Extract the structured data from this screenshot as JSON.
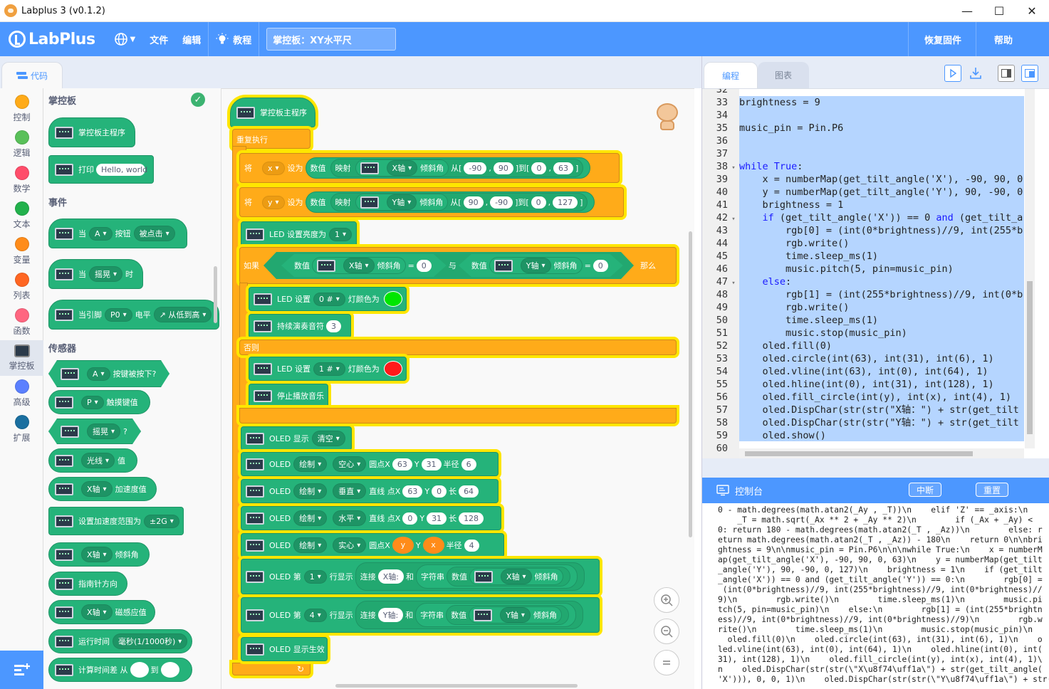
{
  "window": {
    "title": "Labplus 3 (v0.1.2)",
    "minimize": "—",
    "maximize": "☐",
    "close": "✕"
  },
  "header": {
    "logo": "LabPlus",
    "menu_file": "文件",
    "menu_edit": "编辑",
    "menu_tutorial": "教程",
    "project_name": "掌控板：XY水平尺",
    "restore_firmware": "恢复固件",
    "help": "帮助"
  },
  "tabs": {
    "code": "代码",
    "program": "编程",
    "chart": "图表"
  },
  "categories": [
    {
      "label": "控制",
      "color": "#ffab19"
    },
    {
      "label": "逻辑",
      "color": "#59c059"
    },
    {
      "label": "数学",
      "color": "#ff4d6a"
    },
    {
      "label": "文本",
      "color": "#22b14c"
    },
    {
      "label": "变量",
      "color": "#ff8c1a"
    },
    {
      "label": "列表",
      "color": "#ff6622"
    },
    {
      "label": "函数",
      "color": "#ff6680"
    },
    {
      "label": "掌控板",
      "color": "#2b3a4a"
    },
    {
      "label": "高级",
      "color": "#5b80ff"
    },
    {
      "label": "扩展",
      "color": "#1a6fa0"
    }
  ],
  "flyout": {
    "head_board": "掌控板",
    "head_events": "事件",
    "head_sensors": "传感器",
    "blocks": {
      "main_program": "掌控板主程序",
      "print": "打印",
      "print_value": "Hello, world",
      "when": "当",
      "btn_a": "A",
      "button": "按钮",
      "clicked": "被点击",
      "shake": "摇晃",
      "time_suffix": "时",
      "when_pin": "当引脚",
      "pin_p0": "P0",
      "level": "电平",
      "low_to_high": "↗ 从低到高",
      "btn_pressed": "按键被按下?",
      "pin_p": "P",
      "touch_key": "触摸键值",
      "question": "?",
      "light": "光线",
      "value": "值",
      "x_axis": "X轴",
      "accel": "加速度值",
      "set_accel_range": "设置加速度范围为",
      "range_2g": "±2G",
      "tilt": "倾斜角",
      "compass": "指南针方向",
      "mag": "磁感应值",
      "runtime": "运行时间",
      "ms": "毫秒(1/1000秒)",
      "time_diff_from": "计算时间差 从",
      "to": "到"
    }
  },
  "workspace": {
    "hat": "掌控板主程序",
    "repeat": "重复执行",
    "set": "将",
    "var_x": "x",
    "var_y": "y",
    "set_to": "设为",
    "num": "数值",
    "map": "映射",
    "x_axis": "X轴",
    "y_axis": "Y轴",
    "tilt": "倾斜角",
    "from": "从[",
    "to_bracket": "]到[",
    "close_bracket": "]",
    "x_map": [
      "-90",
      "90",
      "0",
      "63"
    ],
    "y_map": [
      "90",
      "-90",
      "0",
      "127"
    ],
    "led_brightness": "LED 设置亮度为",
    "brightness_val": "1",
    "if": "如果",
    "eq": "=",
    "zero": "0",
    "and": "与",
    "then": "那么",
    "led_set": "LED 设置",
    "led0": "0 #",
    "led1": "1 #",
    "light_color": "灯颜色为",
    "color_green": "#00e600",
    "color_red": "#ff1a1a",
    "play_note": "持续演奏音符",
    "note_val": "3",
    "else": "否则",
    "stop_music": "停止播放音乐",
    "oled_show": "OLED 显示",
    "clear": "清空",
    "oled": "OLED",
    "draw": "绘制",
    "hollow": "空心",
    "solid": "实心",
    "vertical": "垂直",
    "horizontal": "水平",
    "circle_x": "圆点X",
    "line_x": "直线 点X",
    "Y": "Y",
    "radius": "半径",
    "len": "长",
    "c1": [
      "63",
      "31",
      "6"
    ],
    "c2": [
      "63",
      "0",
      "64"
    ],
    "c3": [
      "0",
      "31",
      "128"
    ],
    "c4": [
      "y",
      "x",
      "4"
    ],
    "oled_line": "OLED 第",
    "line1": "1",
    "line4": "4",
    "row_show": "行显示",
    "join": "连接",
    "x_label": "X轴:",
    "y_label": "Y轴:",
    "and2": "和",
    "string": "字符串",
    "oled_apply": "OLED 显示生效"
  },
  "editor": {
    "lines": [
      {
        "n": "32",
        "t": ""
      },
      {
        "n": "33",
        "t": "brightness = 9"
      },
      {
        "n": "34",
        "t": ""
      },
      {
        "n": "35",
        "t": "music_pin = Pin.P6"
      },
      {
        "n": "36",
        "t": ""
      },
      {
        "n": "37",
        "t": ""
      },
      {
        "n": "38",
        "t": "while True:",
        "fold": "▾"
      },
      {
        "n": "39",
        "t": "    x = numberMap(get_tilt_angle('X'), -90, 90, 0"
      },
      {
        "n": "40",
        "t": "    y = numberMap(get_tilt_angle('Y'), 90, -90, 0"
      },
      {
        "n": "41",
        "t": "    brightness = 1"
      },
      {
        "n": "42",
        "t": "    if (get_tilt_angle('X')) == 0 and (get_tilt_a",
        "fold": "▾"
      },
      {
        "n": "43",
        "t": "        rgb[0] = (int(0*brightness)//9, int(255*b"
      },
      {
        "n": "44",
        "t": "        rgb.write()"
      },
      {
        "n": "45",
        "t": "        time.sleep_ms(1)"
      },
      {
        "n": "46",
        "t": "        music.pitch(5, pin=music_pin)"
      },
      {
        "n": "47",
        "t": "    else:",
        "fold": "▾"
      },
      {
        "n": "48",
        "t": "        rgb[1] = (int(255*brightness)//9, int(0*b"
      },
      {
        "n": "49",
        "t": "        rgb.write()"
      },
      {
        "n": "50",
        "t": "        time.sleep_ms(1)"
      },
      {
        "n": "51",
        "t": "        music.stop(music_pin)"
      },
      {
        "n": "52",
        "t": "    oled.fill(0)"
      },
      {
        "n": "53",
        "t": "    oled.circle(int(63), int(31), int(6), 1)"
      },
      {
        "n": "54",
        "t": "    oled.vline(int(63), int(0), int(64), 1)"
      },
      {
        "n": "55",
        "t": "    oled.hline(int(0), int(31), int(128), 1)"
      },
      {
        "n": "56",
        "t": "    oled.fill_circle(int(y), int(x), int(4), 1)"
      },
      {
        "n": "57",
        "t": "    oled.DispChar(str(str(\"X轴：\") + str(get_tilt"
      },
      {
        "n": "58",
        "t": "    oled.DispChar(str(str(\"Y轴：\") + str(get_tilt"
      },
      {
        "n": "59",
        "t": "    oled.show()"
      },
      {
        "n": "60",
        "t": ""
      }
    ]
  },
  "console": {
    "title": "控制台",
    "interrupt": "中断",
    "reset": "重置",
    "lines": [
      "0 - math.degrees(math.atan2(_Ay , _T))\\n    elif 'Z' == _axis:\\n",
      "    _T = math.sqrt(_Ax ** 2 + _Ay ** 2)\\n        if (_Ax + _Ay) <",
      "0: return 180 - math.degrees(math.atan2(_T , _Az))\\n        else: r",
      "eturn math.degrees(math.atan2(_T , _Az)) - 180\\n    return 0\\n\\nbri",
      "ghtness = 9\\n\\nmusic_pin = Pin.P6\\n\\n\\nwhile True:\\n    x = numberM",
      "ap(get_tilt_angle('X'), -90, 90, 0, 63)\\n    y = numberMap(get_tilt",
      "_angle('Y'), 90, -90, 0, 127)\\n    brightness = 1\\n    if (get_tilt",
      "_angle('X')) == 0 and (get_tilt_angle('Y')) == 0:\\n        rgb[0] =",
      " (int(0*brightness)//9, int(255*brightness)//9, int(0*brightness)//",
      "9)\\n        rgb.write()\\n        time.sleep_ms(1)\\n        music.pi",
      "tch(5, pin=music_pin)\\n    else:\\n        rgb[1] = (int(255*brightn",
      "ess)//9, int(0*brightness)//9, int(0*brightness)//9)\\n        rgb.w",
      "rite()\\n        time.sleep_ms(1)\\n        music.stop(music_pin)\\n  ",
      "  oled.fill(0)\\n    oled.circle(int(63), int(31), int(6), 1)\\n    o",
      "led.vline(int(63), int(0), int(64), 1)\\n    oled.hline(int(0), int(",
      "31), int(128), 1)\\n    oled.fill_circle(int(y), int(x), int(4), 1)\\",
      "n    oled.DispChar(str(str(\\\"X\\u8f74\\uff1a\\\") + str(get_tilt_angle(",
      "'X'))), 0, 0, 1)\\n    oled.DispChar(str(str(\\\"Y\\u8f74\\uff1a\\\") + str("
    ]
  }
}
